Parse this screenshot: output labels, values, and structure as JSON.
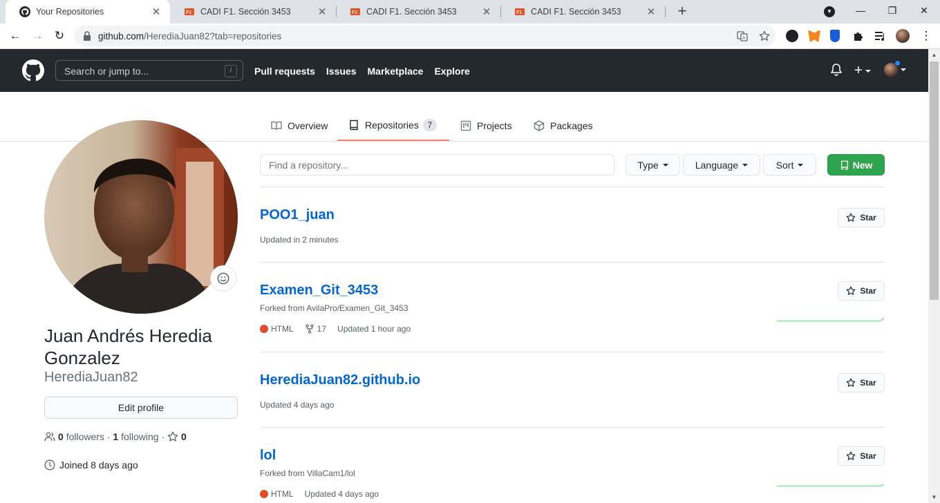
{
  "browser": {
    "tabs": [
      {
        "title": "Your Repositories",
        "close": "✕"
      },
      {
        "title": "CADI F1. Sección 3453",
        "close": "✕"
      },
      {
        "title": "CADI F1. Sección 3453",
        "close": "✕"
      },
      {
        "title": "CADI F1. Sección 3453",
        "close": "✕"
      }
    ],
    "new_tab": "+",
    "url_host": "github.com",
    "url_path": "/HerediaJuan82?tab=repositories",
    "window_controls": {
      "minimize": "—",
      "maximize": "❐",
      "close": "✕"
    }
  },
  "header": {
    "search_placeholder": "Search or jump to...",
    "search_shortcut": "/",
    "nav": [
      "Pull requests",
      "Issues",
      "Marketplace",
      "Explore"
    ],
    "plus": "+"
  },
  "profile_nav": {
    "tabs": [
      {
        "label": "Overview",
        "icon": "book-icon"
      },
      {
        "label": "Repositories",
        "icon": "repo-icon",
        "count": "7",
        "active": true
      },
      {
        "label": "Projects",
        "icon": "project-icon"
      },
      {
        "label": "Packages",
        "icon": "package-icon"
      }
    ]
  },
  "sidebar": {
    "full_name": "Juan Andrés Heredia Gonzalez",
    "login": "HerediaJuan82",
    "edit_profile": "Edit profile",
    "followers_count": "0",
    "followers_label": "followers",
    "separator": "·",
    "following_count": "1",
    "following_label": "following",
    "stars_count": "0",
    "joined": "Joined 8 days ago"
  },
  "repo_filter": {
    "placeholder": "Find a repository...",
    "type_label": "Type",
    "language_label": "Language",
    "sort_label": "Sort",
    "new_label": "New"
  },
  "repos": [
    {
      "name": "POO1_juan",
      "forked_from": "",
      "language": "",
      "forks": "",
      "updated": "Updated in 2 minutes",
      "star": "Star"
    },
    {
      "name": "Examen_Git_3453",
      "forked_from": "Forked from AvilaPro/Examen_Git_3453",
      "language": "HTML",
      "forks": "17",
      "updated": "Updated 1 hour ago",
      "star": "Star"
    },
    {
      "name": "HerediaJuan82.github.io",
      "forked_from": "",
      "language": "",
      "forks": "",
      "updated": "Updated 4 days ago",
      "star": "Star"
    },
    {
      "name": "lol",
      "forked_from": "Forked from VillaCam1/lol",
      "language": "HTML",
      "forks": "",
      "updated": "Updated 4 days ago",
      "star": "Star"
    }
  ],
  "colors": {
    "header_bg": "#24292e",
    "link": "#0366d6",
    "new_button": "#2ea44f",
    "active_tab_underline": "#f9826c",
    "html_language": "#e34c26"
  }
}
